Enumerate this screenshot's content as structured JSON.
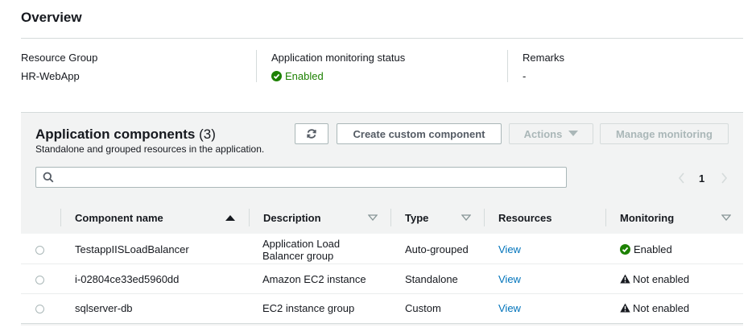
{
  "overview": {
    "title": "Overview",
    "resource_group_label": "Resource Group",
    "resource_group_value": "HR-WebApp",
    "monitoring_status_label": "Application monitoring status",
    "monitoring_status_value": "Enabled",
    "remarks_label": "Remarks",
    "remarks_value": "-"
  },
  "components": {
    "title": "Application components",
    "count": "(3)",
    "subtitle": "Standalone and grouped resources in the application.",
    "refresh_icon": "refresh-icon",
    "create_button": "Create custom component",
    "actions_button": "Actions",
    "manage_button": "Manage monitoring",
    "search_placeholder": "",
    "page_number": "1",
    "columns": {
      "name": "Component name",
      "description": "Description",
      "type": "Type",
      "resources": "Resources",
      "monitoring": "Monitoring"
    },
    "rows": [
      {
        "name": "TestappIISLoadBalancer",
        "description_line1": "Application Load",
        "description_line2": "Balancer group",
        "type": "Auto-grouped",
        "resources": "View",
        "monitoring": "Enabled",
        "monitoring_state": "ok"
      },
      {
        "name": "i-02804ce33ed5960dd",
        "description": "Amazon EC2 instance",
        "type": "Standalone",
        "resources": "View",
        "monitoring": "Not enabled",
        "monitoring_state": "warning"
      },
      {
        "name": "sqlserver-db",
        "description": "EC2 instance group",
        "type": "Custom",
        "resources": "View",
        "monitoring": "Not enabled",
        "monitoring_state": "warning"
      }
    ]
  },
  "colors": {
    "success": "#1d8102",
    "link": "#0073bb",
    "text": "#16191f",
    "panel_bg": "#f2f3f3"
  }
}
